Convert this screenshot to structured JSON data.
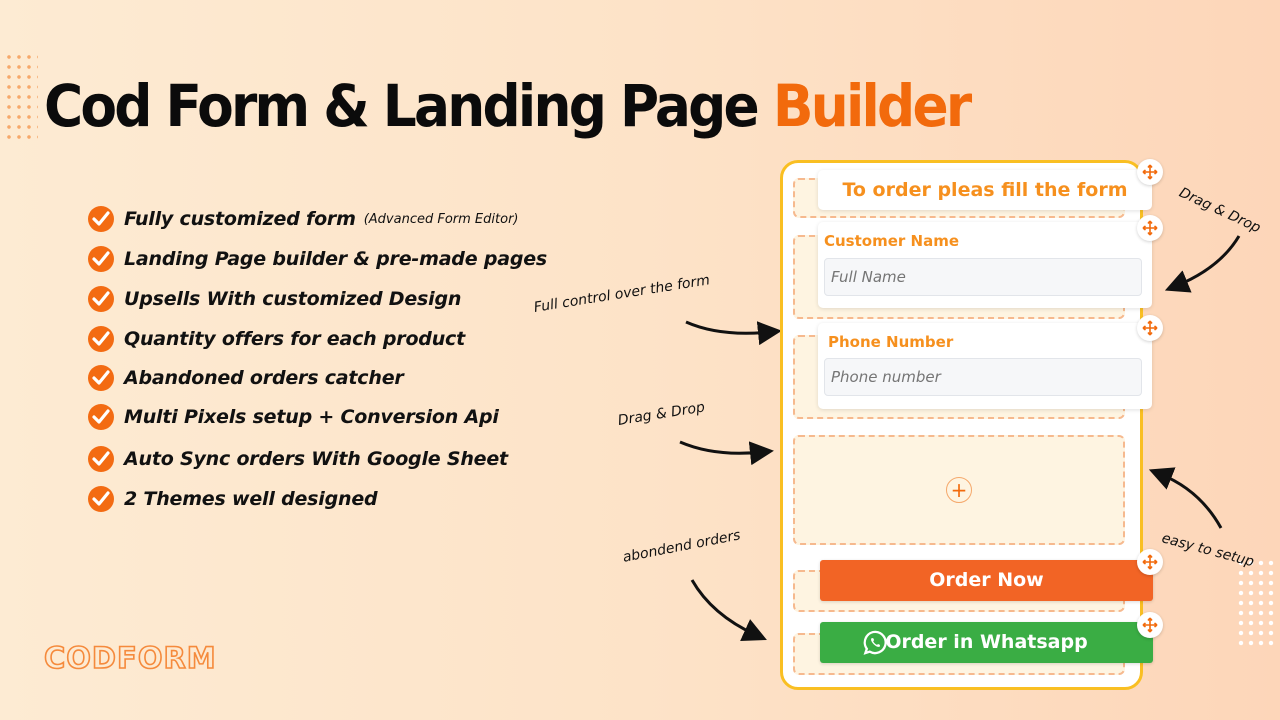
{
  "headline": {
    "main": "Cod Form & Landing Page",
    "accent": "Builder"
  },
  "features": [
    {
      "text": "Fully customized form",
      "sub": "(Advanced Form Editor)"
    },
    {
      "text": "Landing Page builder & pre-made pages"
    },
    {
      "text": "Upsells With customized Design"
    },
    {
      "text": "Quantity offers for each product"
    },
    {
      "text": "Abandoned orders catcher"
    },
    {
      "text": "Multi Pixels setup + Conversion Api"
    },
    {
      "text": "Auto Sync orders With Google Sheet"
    },
    {
      "text": "2 Themes well designed"
    }
  ],
  "annotations": {
    "full_control": "Full control over the form",
    "drag_drop_left": "Drag & Drop",
    "abandoned": "abondend orders",
    "drag_drop_right": "Drag & Drop",
    "easy_setup": "easy to setup"
  },
  "form": {
    "title": "To order pleas fill the form",
    "fields": [
      {
        "label": "Customer Name",
        "placeholder": "Full Name"
      },
      {
        "label": "Phone Number",
        "placeholder": "Phone number"
      }
    ],
    "order_button": "Order Now",
    "whatsapp_button": "Order in Whatsapp",
    "add_block_symbol": "+"
  },
  "logo": "CODFORM",
  "colors": {
    "accent": "#f26a0c",
    "order": "#f26425",
    "whatsapp": "#3aad44",
    "frame": "#f9bf22",
    "label": "#f6901e"
  }
}
